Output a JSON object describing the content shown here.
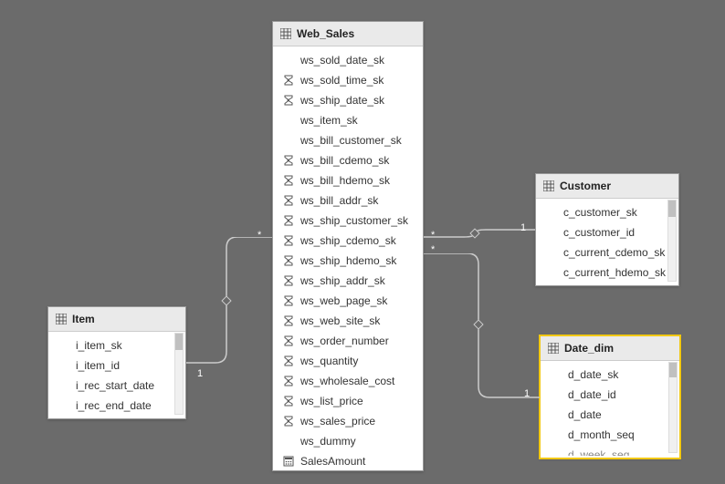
{
  "tables": {
    "item": {
      "title": "Item",
      "fields": [
        {
          "name": "i_item_sk",
          "icon": "none"
        },
        {
          "name": "i_item_id",
          "icon": "none"
        },
        {
          "name": "i_rec_start_date",
          "icon": "none"
        },
        {
          "name": "i_rec_end_date",
          "icon": "none"
        }
      ]
    },
    "web_sales": {
      "title": "Web_Sales",
      "fields": [
        {
          "name": "ws_sold_date_sk",
          "icon": "none"
        },
        {
          "name": "ws_sold_time_sk",
          "icon": "sigma"
        },
        {
          "name": "ws_ship_date_sk",
          "icon": "sigma"
        },
        {
          "name": "ws_item_sk",
          "icon": "none"
        },
        {
          "name": "ws_bill_customer_sk",
          "icon": "none"
        },
        {
          "name": "ws_bill_cdemo_sk",
          "icon": "sigma"
        },
        {
          "name": "ws_bill_hdemo_sk",
          "icon": "sigma"
        },
        {
          "name": "ws_bill_addr_sk",
          "icon": "sigma"
        },
        {
          "name": "ws_ship_customer_sk",
          "icon": "sigma"
        },
        {
          "name": "ws_ship_cdemo_sk",
          "icon": "sigma"
        },
        {
          "name": "ws_ship_hdemo_sk",
          "icon": "sigma"
        },
        {
          "name": "ws_ship_addr_sk",
          "icon": "sigma"
        },
        {
          "name": "ws_web_page_sk",
          "icon": "sigma"
        },
        {
          "name": "ws_web_site_sk",
          "icon": "sigma"
        },
        {
          "name": "ws_order_number",
          "icon": "sigma"
        },
        {
          "name": "ws_quantity",
          "icon": "sigma"
        },
        {
          "name": "ws_wholesale_cost",
          "icon": "sigma"
        },
        {
          "name": "ws_list_price",
          "icon": "sigma"
        },
        {
          "name": "ws_sales_price",
          "icon": "sigma"
        },
        {
          "name": "ws_dummy",
          "icon": "none"
        },
        {
          "name": "SalesAmount",
          "icon": "calc"
        }
      ]
    },
    "customer": {
      "title": "Customer",
      "fields": [
        {
          "name": "c_customer_sk",
          "icon": "none"
        },
        {
          "name": "c_customer_id",
          "icon": "none"
        },
        {
          "name": "c_current_cdemo_sk",
          "icon": "none"
        },
        {
          "name": "c_current_hdemo_sk",
          "icon": "none"
        }
      ]
    },
    "date_dim": {
      "title": "Date_dim",
      "fields": [
        {
          "name": "d_date_sk",
          "icon": "none"
        },
        {
          "name": "d_date_id",
          "icon": "none"
        },
        {
          "name": "d_date",
          "icon": "none"
        },
        {
          "name": "d_month_seq",
          "icon": "none"
        },
        {
          "name": "d_week_seq",
          "icon": "none"
        }
      ]
    }
  },
  "relationships": {
    "item_web": {
      "left": "1",
      "right": "*"
    },
    "web_customer": {
      "left": "*",
      "right": "1"
    },
    "web_date": {
      "left": "*",
      "right": "1"
    }
  }
}
